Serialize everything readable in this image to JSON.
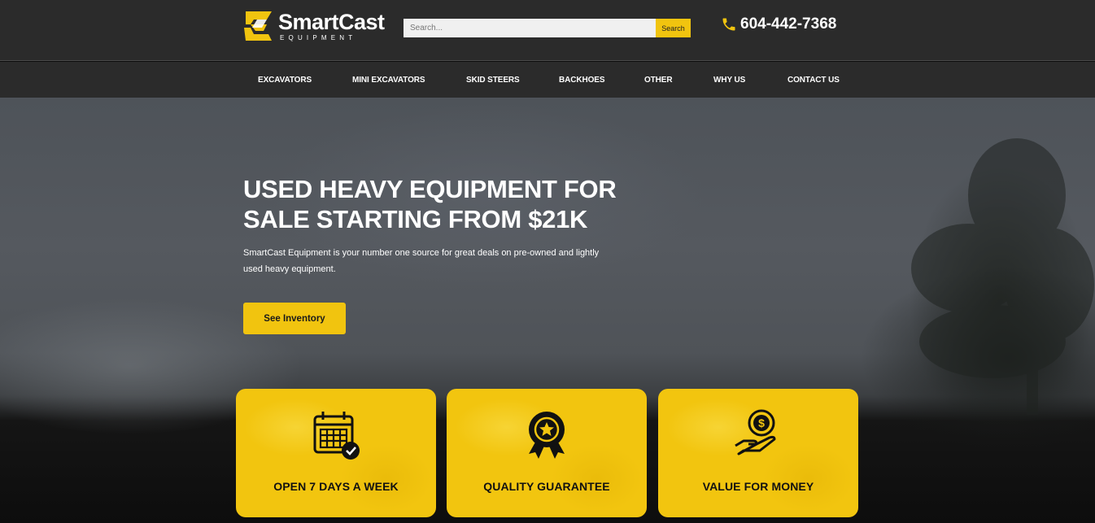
{
  "header": {
    "brand_name": "SmartCast",
    "brand_sub": "EQUIPMENT",
    "search_placeholder": "Search...",
    "search_button": "Search",
    "phone": "604-442-7368"
  },
  "nav": {
    "items": [
      {
        "label": "EXCAVATORS"
      },
      {
        "label": "MINI EXCAVATORS"
      },
      {
        "label": "SKID STEERS"
      },
      {
        "label": "BACKHOES"
      },
      {
        "label": "OTHER"
      },
      {
        "label": "WHY US"
      },
      {
        "label": "CONTACT US"
      }
    ]
  },
  "hero": {
    "title": "USED HEAVY EQUIPMENT FOR SALE STARTING FROM $21K",
    "description": "SmartCast Equipment is your number one source for great deals on pre-owned and lightly used heavy equipment.",
    "cta": "See Inventory"
  },
  "features": [
    {
      "label": "OPEN 7 DAYS A WEEK",
      "icon": "calendar-check-icon"
    },
    {
      "label": "QUALITY GUARANTEE",
      "icon": "award-badge-icon"
    },
    {
      "label": "VALUE FOR MONEY",
      "icon": "coin-hand-icon"
    }
  ],
  "colors": {
    "accent": "#f1c40f",
    "header_bg": "#2b2b2b"
  }
}
